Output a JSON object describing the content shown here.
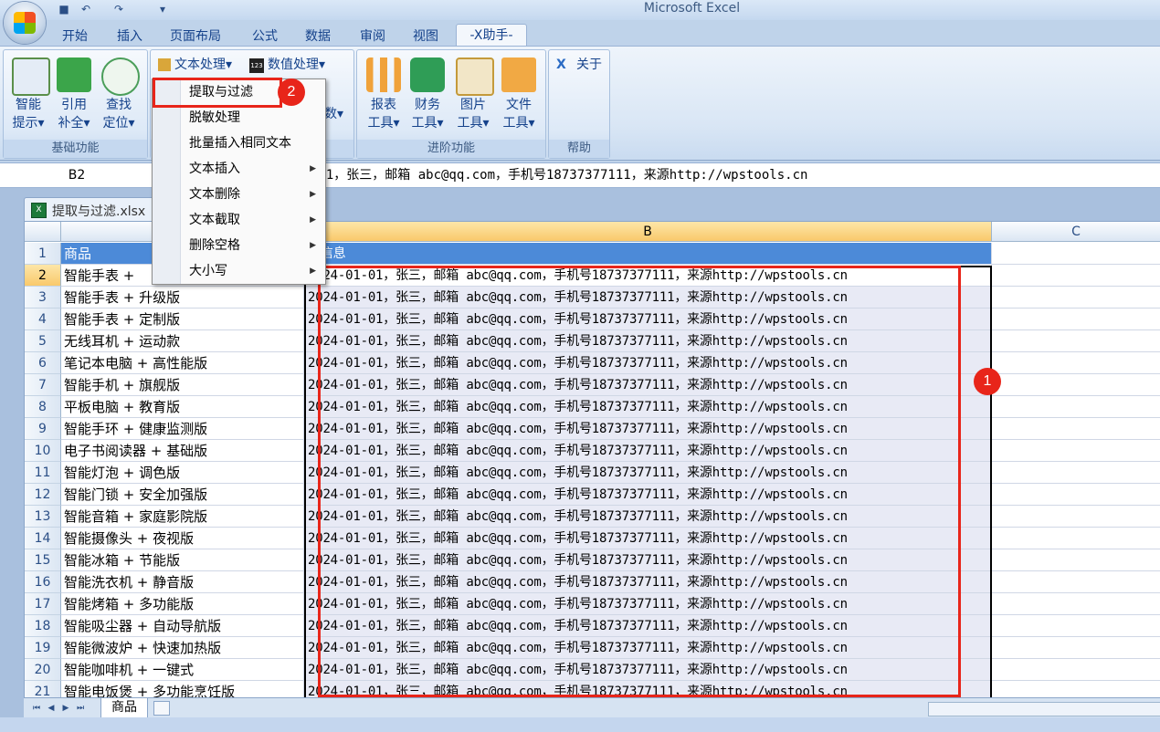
{
  "app_title": "Microsoft Excel",
  "tabs": [
    "开始",
    "插入",
    "页面布局",
    "公式",
    "数据",
    "审阅",
    "视图",
    "-X助手-"
  ],
  "ribbon": {
    "groups": {
      "basic": {
        "label": "基础功能",
        "buttons": [
          {
            "label1": "智能",
            "label2": "提示▾"
          },
          {
            "label1": "引用",
            "label2": "补全▾"
          },
          {
            "label1": "查找",
            "label2": "定位▾"
          }
        ]
      },
      "text": {
        "text_processing": "文本处理▾",
        "number_processing": "数值处理▾",
        "partial_label": "数▾"
      },
      "advanced": {
        "label": "进阶功能",
        "buttons": [
          {
            "label1": "报表",
            "label2": "工具▾"
          },
          {
            "label1": "财务",
            "label2": "工具▾"
          },
          {
            "label1": "图片",
            "label2": "工具▾"
          },
          {
            "label1": "文件",
            "label2": "工具▾"
          }
        ]
      },
      "help": {
        "label": "帮助",
        "about": "关于"
      }
    }
  },
  "formula_bar": {
    "name_box": "B2",
    "formula": "-01，张三，邮箱 abc@qq.com，手机号18737377111，来源http://wpstools.cn"
  },
  "workbook": {
    "tab_label": "提取与过滤.xlsx"
  },
  "grid": {
    "columns": [
      "A",
      "B",
      "C"
    ],
    "header_cells": {
      "a": "商品",
      "b": "买信息"
    },
    "row_numbers": [
      "1",
      "2",
      "3",
      "4",
      "5",
      "6",
      "7",
      "8",
      "9",
      "10",
      "11",
      "12",
      "13",
      "14",
      "15",
      "16",
      "17",
      "18",
      "19",
      "20",
      "21"
    ],
    "products": [
      "智能手表 +",
      "智能手表 + 升级版",
      "智能手表 + 定制版",
      "无线耳机 + 运动款",
      "笔记本电脑 + 高性能版",
      "智能手机 + 旗舰版",
      "平板电脑 + 教育版",
      "智能手环 + 健康监测版",
      "电子书阅读器 + 基础版",
      "智能灯泡 + 调色版",
      "智能门锁 + 安全加强版",
      "智能音箱 + 家庭影院版",
      "智能摄像头 + 夜视版",
      "智能冰箱 + 节能版",
      "智能洗衣机 + 静音版",
      "智能烤箱 + 多功能版",
      "智能吸尘器 + 自动导航版",
      "智能微波炉 + 快速加热版",
      "智能咖啡机 + 一键式",
      "智能电饭煲 + 多功能烹饪版"
    ],
    "purchase_info": "2024-01-01，张三，邮箱 abc@qq.com，手机号18737377111，来源http://wpstools.cn"
  },
  "sheet_tab": "商品",
  "menu": {
    "items": [
      {
        "label": "提取与过滤",
        "submenu": false
      },
      {
        "label": "脱敏处理",
        "submenu": false
      },
      {
        "label": "批量插入相同文本",
        "submenu": false
      },
      {
        "label": "文本插入",
        "submenu": true
      },
      {
        "label": "文本删除",
        "submenu": true
      },
      {
        "label": "文本截取",
        "submenu": true
      },
      {
        "label": "删除空格",
        "submenu": true
      },
      {
        "label": "大小写",
        "submenu": true
      }
    ],
    "arrow_glyph": "▶"
  },
  "callouts": {
    "one": "1",
    "two": "2"
  },
  "colors": {
    "accent_red": "#e8251a",
    "header_blue": "#4c8ad8",
    "selection_fill": "#e8eaf5"
  }
}
